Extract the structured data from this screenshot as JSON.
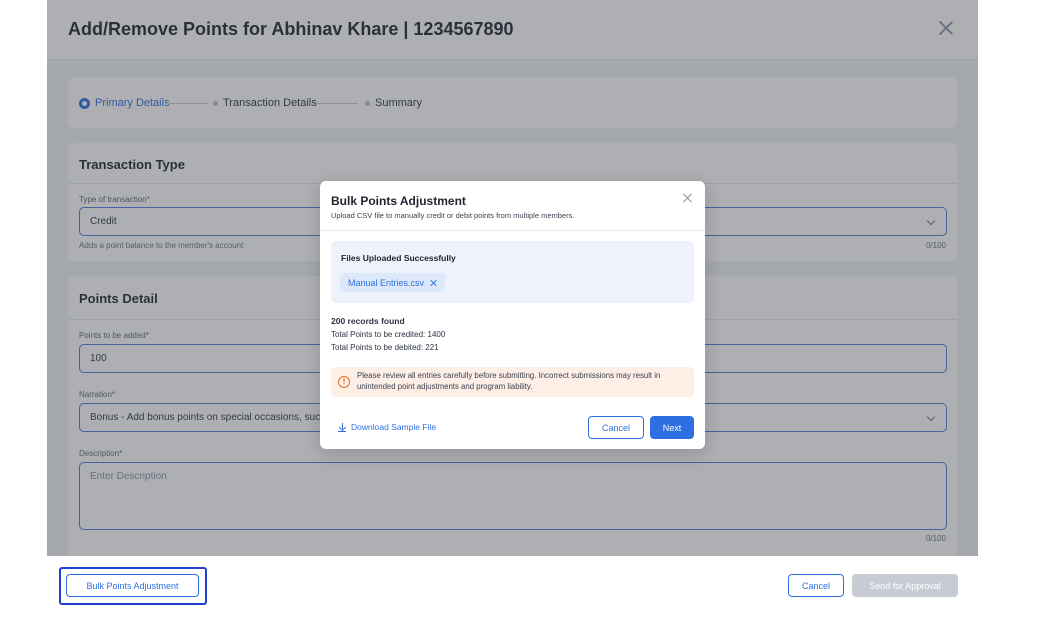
{
  "page": {
    "title": "Add/Remove Points for Abhinav Khare | 1234567890",
    "close_icon": "close-icon"
  },
  "steps": [
    {
      "label": "Primary Details",
      "state": "active"
    },
    {
      "label": "Transaction Details",
      "state": "pending"
    },
    {
      "label": "Summary",
      "state": "pending"
    }
  ],
  "transaction_type": {
    "title": "Transaction Type",
    "field_label": "Type of transaction*",
    "value": "Credit",
    "helper": "Adds a point balance to the member's account",
    "counter": "0/100"
  },
  "points_detail": {
    "title": "Points Detail",
    "points_label": "Points to be added*",
    "points_value": "100",
    "narration_label": "Narration*",
    "narration_value": "Bonus - Add bonus points on special occasions, such",
    "description_label": "Description*",
    "description_placeholder": "Enter Description",
    "description_counter": "0/100"
  },
  "modal": {
    "title": "Bulk Points Adjustment",
    "subtitle": "Upload CSV file to manually credit or debit points from multiple members.",
    "upload_title": "Files Uploaded Successfully",
    "file_name": "Manual Entries.csv",
    "records": "200 records found",
    "credited": "Total Points to be credited: 1400",
    "debited": "Total Points to be debited: 221",
    "warning": "Please review all entries carefully before submitting. Incorrect submissions may result in unintended point adjustments and program liability.",
    "download_link": "Download Sample File",
    "cancel": "Cancel",
    "next": "Next"
  },
  "footer": {
    "bulk": "Bulk Points Adjustment",
    "cancel": "Cancel",
    "send": "Send for Approval"
  },
  "colors": {
    "accent": "#2d6fe0",
    "warning_bg": "#fdeee6",
    "warning_icon": "#e0702b",
    "disabled": "#c7cbd4",
    "highlight": "#1f3fd0"
  }
}
